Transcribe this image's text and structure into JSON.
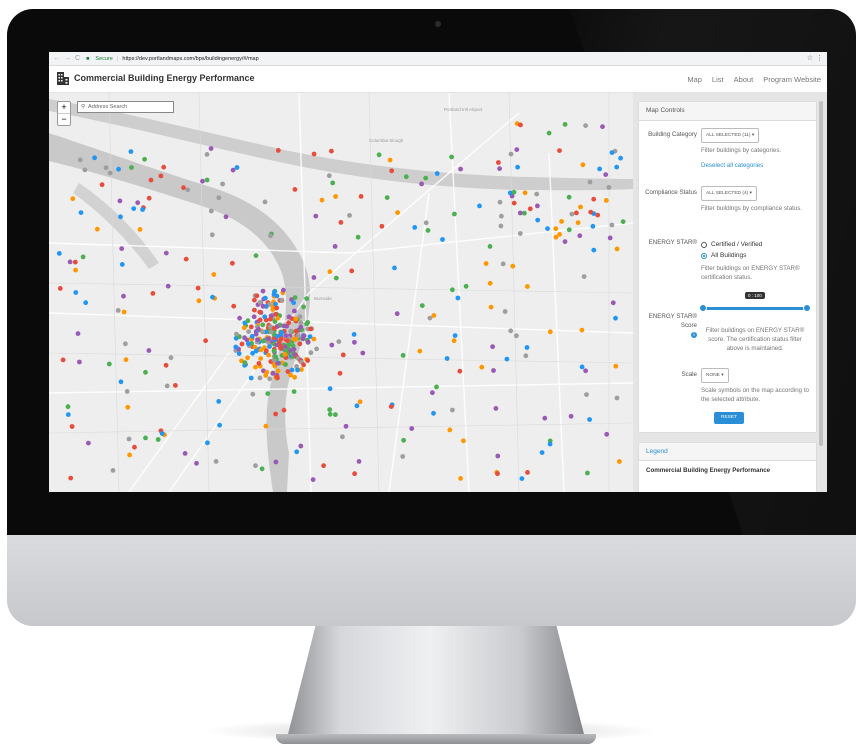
{
  "browser": {
    "secure_label": "Secure",
    "url": "https://dev.portlandmaps.com/bps/buildingenergy/#/map"
  },
  "app": {
    "title": "Commercial Building Energy Performance",
    "nav": [
      "Map",
      "List",
      "About",
      "Program Website"
    ]
  },
  "map": {
    "zoom_in": "+",
    "zoom_out": "−",
    "search_placeholder": "Address Search",
    "labels": [
      "Portland Intl Airport",
      "Columbia Slough",
      "Burnside"
    ]
  },
  "controls": {
    "title": "Map Controls",
    "building_category": {
      "label": "Building Category",
      "dropdown": "ALL SELECTED (11) ▾",
      "help": "Filter buildings by categories.",
      "link": "Deselect all categories"
    },
    "compliance_status": {
      "label": "Compliance Status",
      "dropdown": "ALL SELECTED (4) ▾",
      "help": "Filter buildings by compliance status."
    },
    "energy_star": {
      "label": "ENERGY STAR®",
      "options": [
        "Certified / Verified",
        "All Buildings"
      ],
      "selected": 1,
      "help": "Filter buildings on ENERGY STAR® certification status."
    },
    "energy_star_score": {
      "label": "ENERGY STAR® Score",
      "tooltip": "0 : 100",
      "range": [
        0,
        100
      ],
      "help": "Filter buildings on ENERGY STAR® score. The certification status filter above is maintained."
    },
    "scale": {
      "label": "Scale",
      "dropdown": "NONE ▾",
      "help": "Scale symbols on the map according to the selected attribute."
    },
    "reset": "RESET"
  },
  "legend": {
    "title": "Legend",
    "subtitle": "Commercial Building Energy Performance"
  },
  "colors": {
    "accent": "#2a8fd6",
    "marker_colors": [
      "#9b59b6",
      "#e74c3c",
      "#4caf50",
      "#ff9800",
      "#2196f3",
      "#9e9e9e"
    ]
  }
}
